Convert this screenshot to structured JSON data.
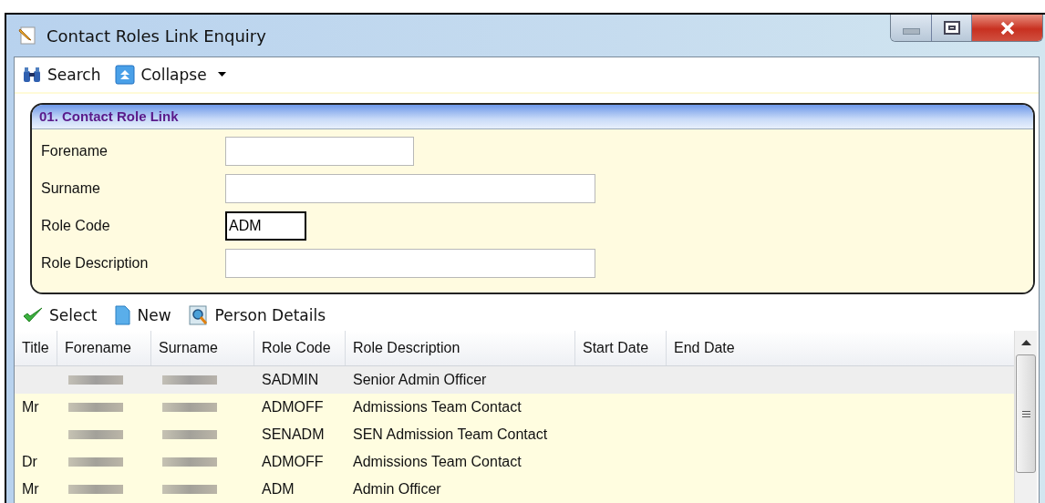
{
  "window": {
    "title": "Contact Roles Link Enquiry"
  },
  "toolbar": [
    {
      "kind": "search",
      "label": "Search"
    },
    {
      "kind": "collapse",
      "label": "Collapse"
    }
  ],
  "panel": {
    "title": "01. Contact Role Link",
    "fields": [
      {
        "label": "Forename",
        "focused": false
      },
      {
        "label": "Surname",
        "focused": false
      },
      {
        "label": "Role Code",
        "value": "ADM",
        "focused": true
      },
      {
        "label": "Role Description",
        "focused": false
      }
    ]
  },
  "actions": [
    {
      "kind": "select",
      "label": "Select"
    },
    {
      "kind": "new",
      "label": "New"
    },
    {
      "kind": "person",
      "label": "Person Details"
    }
  ],
  "table": {
    "columns": [
      "Title",
      "Forename",
      "Surname",
      "Role Code",
      "Role Description",
      "Start Date",
      "End Date"
    ],
    "rows": [
      {
        "role_code": "SADMIN",
        "role_description": "Senior Admin Officer",
        "selected": true
      },
      {
        "title": "Mr",
        "role_code": "ADMOFF",
        "role_description": "Admissions Team Contact",
        "selected": false
      },
      {
        "role_code": "SENADM",
        "role_description": "SEN Admission Team Contact",
        "selected": false
      },
      {
        "title": "Dr",
        "role_code": "ADMOFF",
        "role_description": "Admissions Team Contact",
        "selected": false
      },
      {
        "title": "Mr",
        "role_code": "ADM",
        "role_description": "Admin Officer",
        "selected": false
      }
    ]
  }
}
